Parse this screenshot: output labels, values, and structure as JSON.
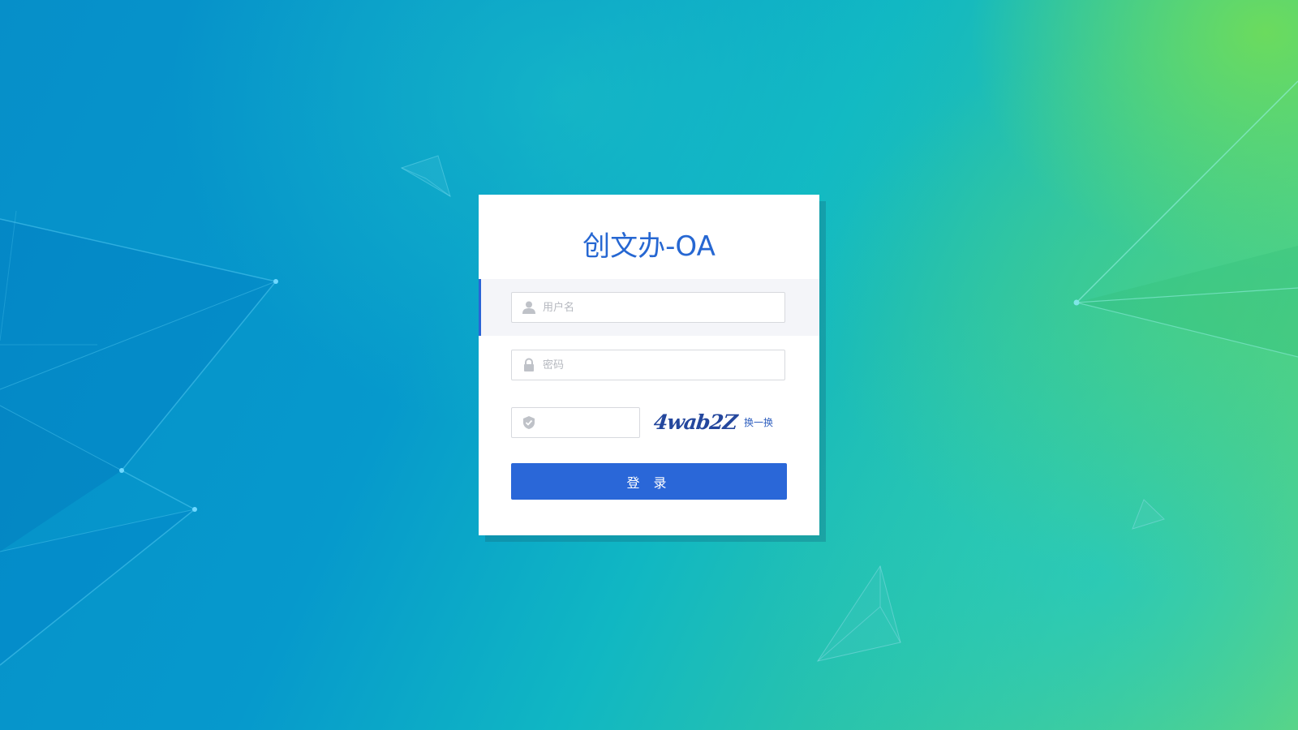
{
  "app": {
    "title": "创文办-OA"
  },
  "form": {
    "username": {
      "placeholder": "用户名",
      "value": "",
      "icon": "user-icon"
    },
    "password": {
      "placeholder": "密码",
      "value": "",
      "icon": "lock-icon"
    },
    "captcha": {
      "value": "",
      "icon": "shield-check-icon",
      "image_text": "4wab2Z",
      "refresh_label": "换一换"
    },
    "login_label": "登 录"
  },
  "colors": {
    "accent": "#2a67d8",
    "title": "#2667d2",
    "captcha_text": "#24479d"
  }
}
